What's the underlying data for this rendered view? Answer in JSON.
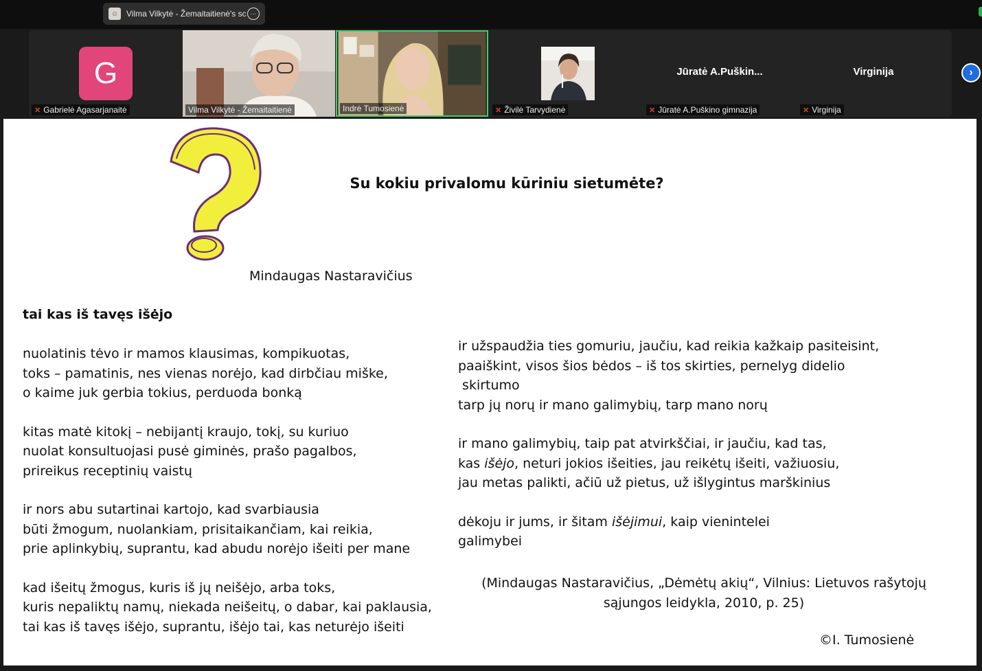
{
  "topbar": {
    "share_label": "Vilma Vilkytė - Žemaitaitienė's sc",
    "more_icon": "more-options-icon"
  },
  "participants": [
    {
      "name": "Gabrielė Agasarjanaitė",
      "initial": "G",
      "muted": true,
      "video": false,
      "avatar_color": "#e2457a"
    },
    {
      "name": "Vilma Vilkytė - Žemaitaitienė",
      "muted": false,
      "video": true
    },
    {
      "name": "Indrė Tumosienė",
      "muted": false,
      "video": true,
      "active_speaker": true
    },
    {
      "name": "Živilė Tarvydienė",
      "muted": true,
      "video": true
    },
    {
      "name": "Jūratė A.Puškino gimnazija",
      "display_title": "Jūratė  A.Puškin...",
      "muted": true,
      "video": false
    },
    {
      "name": "Virginija",
      "display_title": "Virginija",
      "muted": true,
      "video": false
    }
  ],
  "slide": {
    "title": "Su kokiu privalomu kūriniu sietumėte?",
    "author": "Mindaugas Nastaravičius",
    "poem_title": "tai kas iš tavęs išėjo",
    "left_stanzas": [
      [
        "nuolatinis tėvo ir mamos klausimas, kompikuotas,",
        "toks – pamatinis, nes vienas norėjo, kad dirbčiau miške,",
        "o kaime juk gerbia tokius, perduoda bonką"
      ],
      [
        "kitas matė kitokį – nebijantį kraujo, tokį, su kuriuo",
        "nuolat konsultuojasi pusė giminės, prašo pagalbos,",
        "prireikus receptinių vaistų"
      ],
      [
        "ir nors abu sutartinai kartojo, kad svarbiausia",
        "būti žmogum, nuolankiam, prisitaikančiam, kai reikia,",
        "prie aplinkybių, suprantu, kad abudu norėjo išeiti per mane"
      ],
      [
        "kad išeitų žmogus, kuris iš jų neišėjo, arba toks,",
        "kuris nepaliktų namų, niekada neišeitų, o dabar, kai paklausia,",
        "tai kas iš tavęs išėjo, suprantu, išėjo tai, kas neturėjo išeiti"
      ]
    ],
    "right_stanza1": [
      "ir užspaudžia ties gomuriu, jaučiu, kad reikia kažkaip pasiteisint,",
      "paaiškint, visos šios bėdos – iš tos skirties, pernelyg didelio",
      " skirtumo",
      "tarp jų norų ir mano galimybių, tarp mano norų"
    ],
    "right_stanza2": {
      "line1": "ir mano galimybių, taip pat atvirkščiai, ir jaučiu, kad tas,",
      "line2_before": "kas ",
      "line2_italic": "išėjo",
      "line2_after": ", neturi jokios išeities, jau reikėtų išeiti, važiuosiu,",
      "line3": "jau metas palikti, ačiū už pietus, už išlygintus marškinius"
    },
    "right_stanza3": {
      "line1_before": "dėkoju ir jums, ir šitam ",
      "line1_italic": "išėjimui",
      "line1_after": ", kaip vienintelei",
      "line2": "galimybei"
    },
    "citation_line1": "(Mindaugas Nastaravičius, „Dėmėtų akių“, Vilnius: Lietuvos rašytojų",
    "citation_line2": "sąjungos leidykla, 2010, p. 25)",
    "copyright": "©I. Tumosienė"
  },
  "colors": {
    "active_speaker_border": "#3ecf6b",
    "mute_icon": "#e0413c",
    "next_button": "#1e6de0",
    "question_mark_fill": "#f2ee3c",
    "question_mark_stroke": "#6b2d7a"
  }
}
